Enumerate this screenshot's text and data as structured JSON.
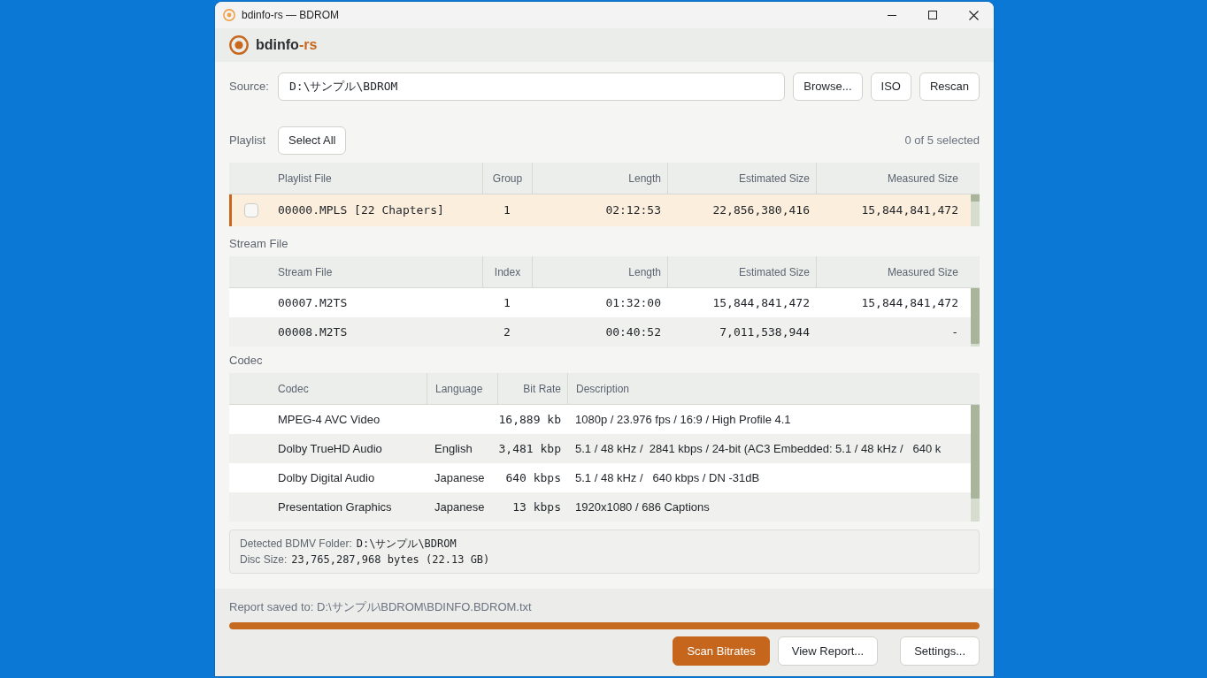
{
  "window": {
    "title": "bdinfo-rs — BDROM"
  },
  "header": {
    "app_name": "bdinfo",
    "app_name_accent": "-rs"
  },
  "source": {
    "label": "Source:",
    "value": "D:\\サンプル\\BDROM",
    "buttons": [
      "Browse...",
      "ISO",
      "Rescan"
    ]
  },
  "playlist": {
    "label": "Playlist",
    "select_all_button": "Select All",
    "selection_count": "0 of 5 selected",
    "table": {
      "columns": [
        {
          "label": "Playlist File",
          "kind": "file"
        },
        {
          "label": "Group",
          "kind": "count"
        },
        {
          "label": "Length",
          "kind": "number"
        },
        {
          "label": "Estimated Size",
          "kind": "number"
        },
        {
          "label": "Measured Size",
          "kind": "number"
        }
      ],
      "rows": [
        {
          "selected": true,
          "checked": false,
          "playlist_file": "00000.MPLS [22 Chapters]",
          "group": "1",
          "length": "02:12:53",
          "estimated_size": "22,856,380,416",
          "measured_size": "15,844,841,472"
        }
      ]
    }
  },
  "stream_files": {
    "title": "Stream File",
    "table": {
      "columns": [
        {
          "label": "Stream File",
          "kind": "file"
        },
        {
          "label": "Index",
          "kind": "count"
        },
        {
          "label": "Length",
          "kind": "number"
        },
        {
          "label": "Estimated Size",
          "kind": "number"
        },
        {
          "label": "Measured Size",
          "kind": "number"
        }
      ],
      "rows": [
        {
          "stream_file": "00007.M2TS",
          "index": "1",
          "length": "01:32:00",
          "estimated_size": "15,844,841,472",
          "measured_size": "15,844,841,472"
        },
        {
          "stream_file": "00008.M2TS",
          "index": "2",
          "length": "00:40:52",
          "estimated_size": "7,011,538,944",
          "measured_size": "-"
        }
      ]
    }
  },
  "codecs": {
    "title": "Codec",
    "table": {
      "columns": [
        {
          "label": "Codec",
          "kind": "text"
        },
        {
          "label": "Language",
          "kind": "text"
        },
        {
          "label": "Bit Rate",
          "kind": "number"
        },
        {
          "label": "Description",
          "kind": "text"
        }
      ],
      "rows": [
        {
          "codec": "MPEG-4 AVC Video",
          "bit_rate": "16,889 kb",
          "description": "1080p / 23.976 fps / 16:9 / High Profile 4.1"
        },
        {
          "codec": "Dolby TrueHD Audio",
          "language": "English",
          "bit_rate": "3,481 kbp",
          "description": "5.1 / 48 kHz /  2841 kbps / 24-bit (AC3 Embedded: 5.1 / 48 kHz /   640 k"
        },
        {
          "codec": "Dolby Digital Audio",
          "language": "Japanese",
          "bit_rate": "640 kbps",
          "description": "5.1 / 48 kHz /   640 kbps / DN -31dB"
        },
        {
          "codec": "Presentation Graphics",
          "language": "Japanese",
          "bit_rate": "13 kbps",
          "description": "1920x1080 / 686 Captions"
        }
      ]
    }
  },
  "disc_info": [
    {
      "label": "Detected BDMV Folder:",
      "value": "D:\\サンプル\\BDROM"
    },
    {
      "label": "Disc Size:",
      "value": "23,765,287,968 bytes (22.13 GB)"
    }
  ],
  "status_bar": {
    "text": "Report saved to: D:\\サンプル\\BDROM\\BDINFO.BDROM.txt",
    "progress": {
      "level": 1
    },
    "buttons": [
      {
        "label": "Scan Bitrates",
        "kind": "primary"
      },
      {
        "label": "View Report...",
        "kind": "secondary"
      },
      {
        "label": "Settings...",
        "kind": "secondary"
      }
    ]
  }
}
